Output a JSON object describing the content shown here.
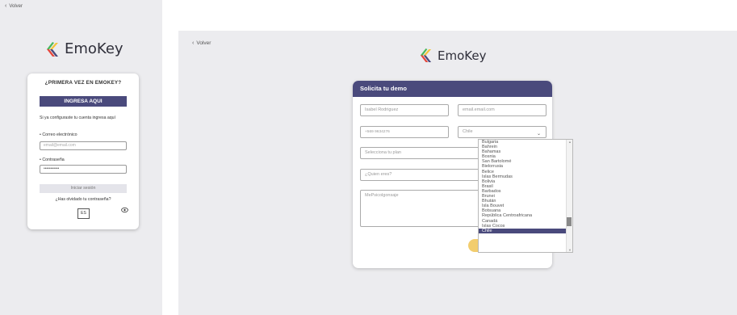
{
  "login": {
    "back_label": "Volver",
    "brand": "EmoKey",
    "card_title": "¿PRIMERA VEZ EN EMOKEY?",
    "ingresa_button": "INGRESA AQUI",
    "configured_text": "Si ya configuraste tu cuenta ingresa aquí",
    "email_label": "Correo electrónico",
    "email_placeholder": "email@email.com",
    "password_label": "Contraseña",
    "password_value": "•••••••••••",
    "login_button": "Iniciar sesión",
    "forgot_link": "¿Has olvidado tu contraseña?",
    "language": "ES"
  },
  "demo": {
    "back_label": "Volver",
    "brand": "EmoKey",
    "header": "Solicita tu demo",
    "name_value": "Isabel Rodriguez",
    "email_value": "email.email.com",
    "phone_value": "+569 9634276",
    "country_value": "Chile",
    "plan_placeholder": "Selecciona tu plan",
    "who_placeholder": "¿Quien eres?",
    "message_value": "MePsicolgonsaje"
  },
  "dropdown": {
    "options": [
      "Bulgaria",
      "Bahrein",
      "Bahamas",
      "Bosnia",
      "San Bartolomé",
      "Bielorrusia",
      "Belice",
      "Islas Bermudas",
      "Bolivia",
      "Brasil",
      "Barbados",
      "Brunei",
      "Bhután",
      "Isla Bouvet",
      "Botsuana",
      "República Centroafricana",
      "Canadá",
      "Islas Cocos",
      "Chile"
    ],
    "selected": "Chile"
  },
  "colors": {
    "accent": "#4a4a7c",
    "submit": "#f2cd6e",
    "panel_bg": "#ececef",
    "logo_green": "#49b85c",
    "logo_yellow": "#f4c33a",
    "logo_red": "#e5473c",
    "logo_purple": "#4a4a7c"
  }
}
